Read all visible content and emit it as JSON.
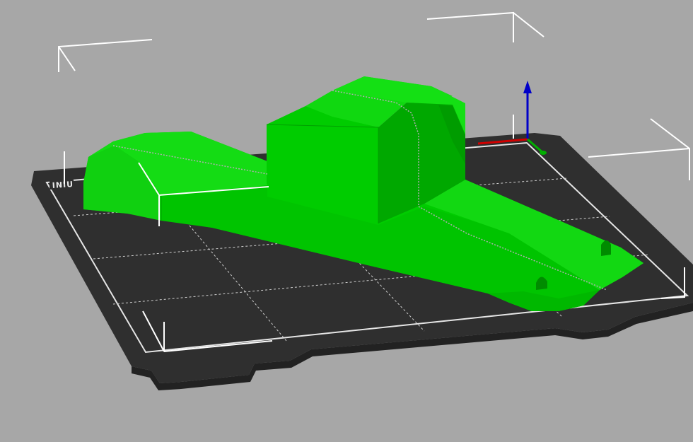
{
  "viewport": {
    "background_color": "#a7a7a7",
    "view": "3d-perspective"
  },
  "bed": {
    "plate_color": "#2f2f2f",
    "plate_shadow_color": "#222222",
    "grid_color": "#d9d9d9",
    "outline_color": "#ffffff",
    "logo_text": "INIU"
  },
  "model": {
    "color": "#00cc00",
    "dark_color": "#00a800",
    "light_color": "#14e014",
    "seam_color": "#b8b8b8"
  },
  "gizmo": {
    "z_axis_color": "#0000c8",
    "x_axis_color": "#d00000",
    "y_axis_color": "#00b000"
  },
  "bounding_box": {
    "color": "#ffffff"
  }
}
